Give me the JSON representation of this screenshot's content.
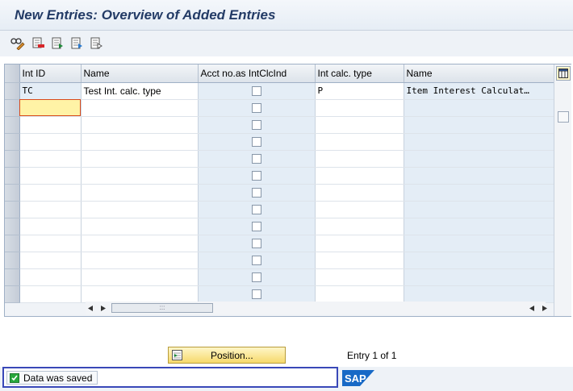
{
  "title": "New Entries: Overview of Added Entries",
  "toolbar": {
    "icons": [
      "glasses-edit-icon",
      "delete-row-icon",
      "select-all-icon",
      "select-block-icon",
      "deselect-all-icon"
    ]
  },
  "table": {
    "headers": [
      "Int ID",
      "Name",
      "Acct no.as IntClcInd",
      "Int calc. type",
      "Name"
    ],
    "rows": [
      {
        "int_id": "TC",
        "name": "Test Int. calc. type",
        "acct_checked": false,
        "calc_type": "P",
        "calc_name": "Item Interest Calculat…"
      }
    ],
    "empty_rows": 12
  },
  "position_button": {
    "label": "Position..."
  },
  "entry_count": "Entry 1 of 1",
  "status": {
    "message": "Data was saved"
  },
  "logo": "SAP"
}
